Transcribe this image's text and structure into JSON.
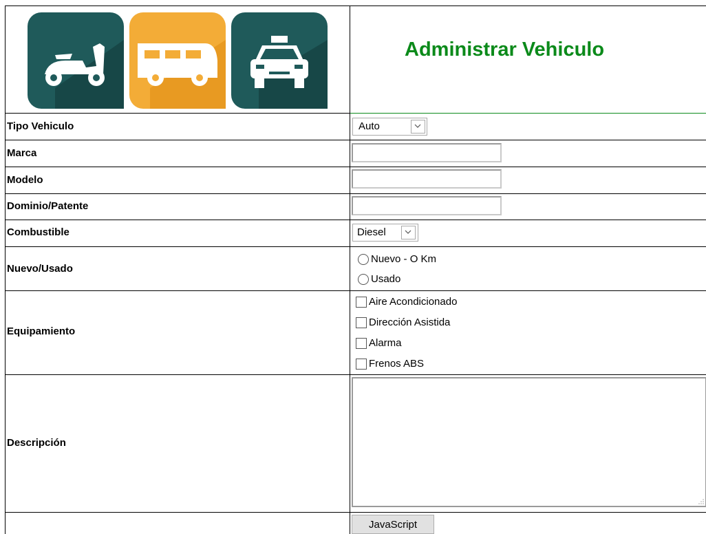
{
  "header": {
    "title": "Administrar Vehiculo",
    "icons": [
      "scooter-icon",
      "van-icon",
      "taxi-icon"
    ],
    "icon_colors": [
      "#1f5a5a",
      "#f3ac37",
      "#1f5a5a"
    ],
    "title_color": "#0b8a1a"
  },
  "form": {
    "tipo_label": "Tipo Vehiculo",
    "tipo_value": "Auto",
    "marca_label": "Marca",
    "modelo_label": "Modelo",
    "dominio_label": "Dominio/Patente",
    "combustible_label": "Combustible",
    "combustible_value": "Diesel",
    "nuevo_label": "Nuevo/Usado",
    "nuevo_options": [
      "Nuevo - O Km",
      "Usado"
    ],
    "equip_label": "Equipamiento",
    "equip_options": [
      "Aire Acondicionado",
      "Dirección Asistida",
      "Alarma",
      "Frenos ABS"
    ],
    "desc_label": "Descripción",
    "submit_label": "JavaScript"
  }
}
